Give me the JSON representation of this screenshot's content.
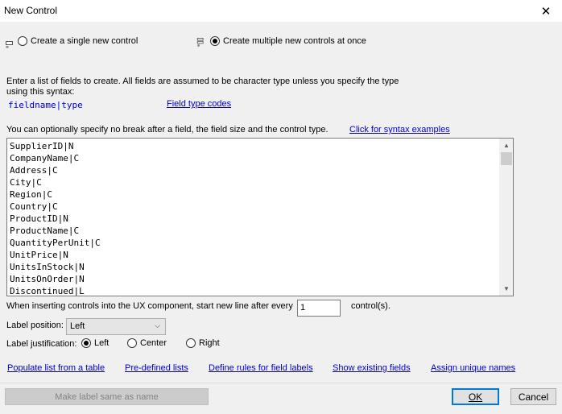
{
  "window": {
    "title": "New Control",
    "close_glyph": "✕"
  },
  "mode": {
    "single_label": "Create a single new control",
    "multiple_label": "Create multiple new controls at once",
    "selected": "multiple"
  },
  "instructions": {
    "line1": "Enter a list of fields to create. All fields are assumed to be character type unless you specify the type",
    "line2": "using this syntax:",
    "syntax": "fieldname|type",
    "field_type_codes_link": "Field type codes",
    "optional_text": "You can optionally specify no break after a field, the field size and the control type.",
    "syntax_examples_link": "Click for syntax examples"
  },
  "fields_list": [
    "SupplierID|N",
    "CompanyName|C",
    "Address|C",
    "City|C",
    "Region|C",
    "Country|C",
    "ProductID|N",
    "ProductName|C",
    "QuantityPerUnit|C",
    "UnitPrice|N",
    "UnitsInStock|N",
    "UnitsOnOrder|N",
    "Discontinued|L"
  ],
  "new_line": {
    "label_before": "When inserting controls into the UX component, start new line after every",
    "value": "1",
    "label_after": "control(s)."
  },
  "label_position": {
    "label": "Label position:",
    "value": "Left"
  },
  "label_justification": {
    "label": "Label justification:",
    "options": [
      "Left",
      "Center",
      "Right"
    ],
    "selected": "Left"
  },
  "links": {
    "populate": "Populate list from a table",
    "predefined": "Pre-defined lists",
    "define_rules": "Define rules for field labels",
    "show_existing": "Show existing fields",
    "assign_unique": "Assign unique names"
  },
  "buttons": {
    "make_label": "Make label same as name",
    "ok": "OK",
    "cancel": "Cancel"
  },
  "colors": {
    "link": "#0000cc",
    "default_button_border": "#0078d7",
    "dialog_background": "#f0f0f0"
  }
}
